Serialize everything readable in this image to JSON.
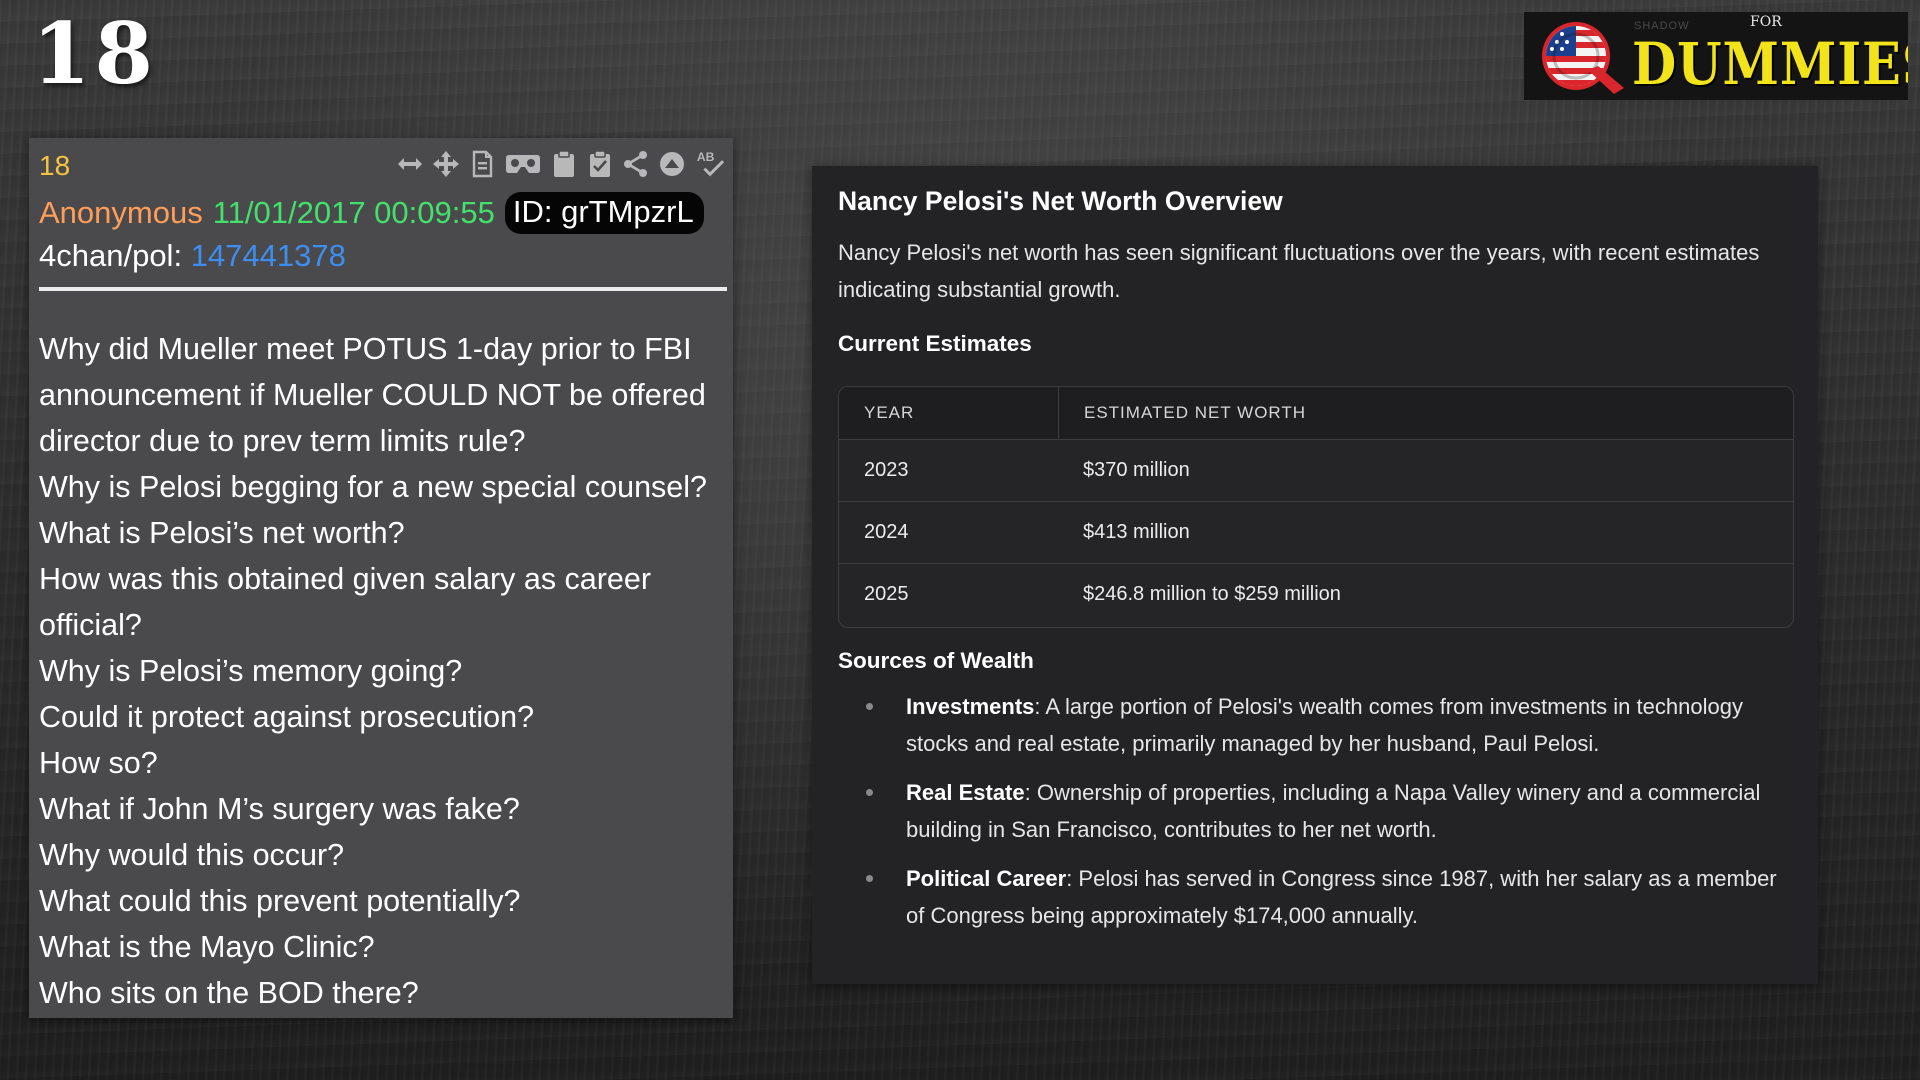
{
  "slide": {
    "number": "18"
  },
  "logo": {
    "for_text": "FOR",
    "shadow_text": "SHADOW",
    "brand_text": "DUMMIES",
    "q_letter": "Q"
  },
  "post": {
    "number": "18",
    "author": "Anonymous",
    "timestamp": "11/01/2017 00:09:55",
    "id_label": "ID: grTMpzrL",
    "board": "4chan/pol:",
    "thread_link": "147441378",
    "toolbar_icons": [
      "expand-horizontal-icon",
      "move-icon",
      "document-icon",
      "vr-goggles-icon",
      "clipboard-icon",
      "clipboard-check-icon",
      "share-icon",
      "upvote-circle-icon",
      "spellcheck-icon"
    ],
    "toolbar_ab": "AB",
    "lines": [
      "Why did Mueller meet POTUS 1-day prior to FBI",
      "announcement if Mueller COULD NOT be offered",
      "director due to prev term limits rule?",
      "Why is Pelosi begging for a new special counsel?",
      "What is Pelosi’s net worth?",
      "How was this obtained given salary as career",
      "official?",
      "Why is Pelosi’s memory going?",
      "Could it protect against prosecution?",
      "How so?",
      "What if John M’s surgery was fake?",
      "Why would this occur?",
      "What could this prevent potentially?",
      "What is the Mayo Clinic?",
      "Who sits on the BOD there?"
    ]
  },
  "panel": {
    "title": "Nancy Pelosi's Net Worth Overview",
    "intro": "Nancy Pelosi's net worth has seen significant fluctuations over the years, with recent estimates indicating substantial growth.",
    "estimates_heading": "Current Estimates",
    "table": {
      "headers": [
        "YEAR",
        "ESTIMATED NET WORTH"
      ],
      "rows": [
        [
          "2023",
          "$370 million"
        ],
        [
          "2024",
          "$413 million"
        ],
        [
          "2025",
          "$246.8 million to $259 million"
        ]
      ]
    },
    "sources_heading": "Sources of Wealth",
    "sources": [
      {
        "term": "Investments",
        "text": ": A large portion of Pelosi's wealth comes from investments in technology stocks and real estate, primarily managed by her husband, Paul Pelosi."
      },
      {
        "term": "Real Estate",
        "text": ": Ownership of properties, including a Napa Valley winery and a commercial building in San Francisco, contributes to her net worth."
      },
      {
        "term": "Political Career",
        "text": ": Pelosi has served in Congress since 1987, with her salary as a member of Congress being approximately $174,000 annually."
      }
    ]
  },
  "colors": {
    "post_number": "#f5c542",
    "author": "#ff9e58",
    "timestamp": "#44e06c",
    "link": "#3d8ef0",
    "logo_yellow": "#f2e31b",
    "logo_red": "#d8262c"
  }
}
